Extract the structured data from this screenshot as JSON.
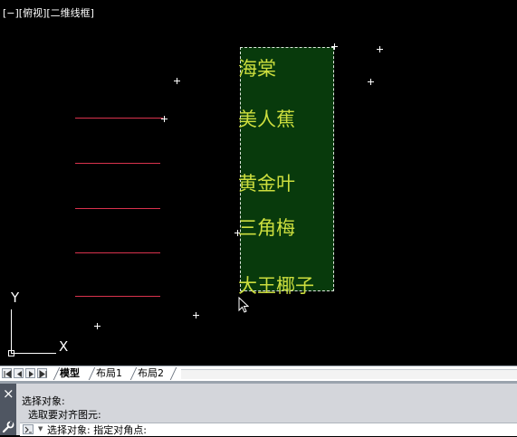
{
  "viewport": {
    "title": "[−][俯视][二维线框]",
    "plants": [
      "海棠",
      "美人蕉",
      "黄金叶",
      "三角梅",
      "大王椰子"
    ],
    "ucs": {
      "y_label": "Y",
      "x_label": "X"
    }
  },
  "layout_tabs": {
    "tabs": [
      {
        "label": "模型",
        "active": true
      },
      {
        "label": "布局1",
        "active": false
      },
      {
        "label": "布局2",
        "active": false
      }
    ]
  },
  "command_window": {
    "history": [
      "选择对象:",
      "  选取要对齐图元:"
    ],
    "current_input": "选择对象: 指定对角点:"
  },
  "colors": {
    "background": "#000000",
    "selection_fill": "#083a0c",
    "plant_text": "#ccde3e",
    "leader_line": "#d9324d"
  }
}
